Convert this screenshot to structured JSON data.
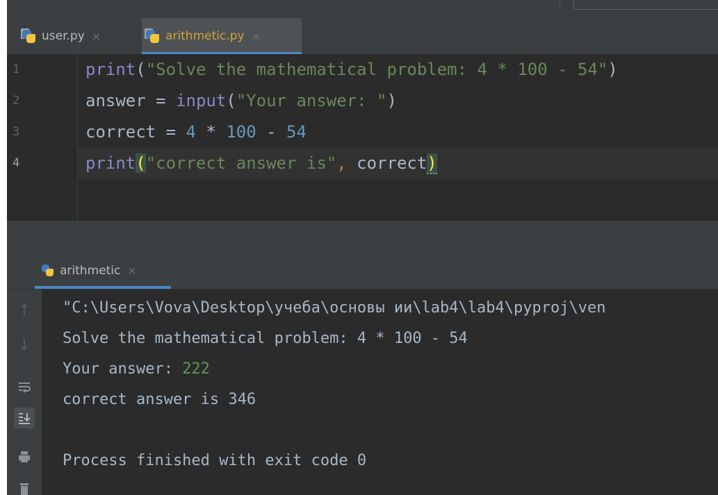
{
  "editor_tabs": [
    {
      "file": "user.py",
      "close": "×"
    },
    {
      "file": "arithmetic.py",
      "close": "×"
    }
  ],
  "line_numbers": [
    "1",
    "2",
    "3",
    "4"
  ],
  "code": {
    "l1_fn": "print",
    "l1_open": "(",
    "l1_str": "\"Solve the mathematical problem: 4 * 100 - 54\"",
    "l1_close": ")",
    "l2_var": "answer = ",
    "l2_fn": "input",
    "l2_open": "(",
    "l2_str": "\"Your answer: \"",
    "l2_close": ")",
    "l3_var": "correct = ",
    "l3_n1": "4",
    "l3_op1": " * ",
    "l3_n2": "100",
    "l3_op2": " - ",
    "l3_n3": "54",
    "l4_fn": "print",
    "l4_open": "(",
    "l4_str": "\"correct answer is\"",
    "l4_comma": ",",
    "l4_arg": " correct",
    "l4_close": ")"
  },
  "run_tab": {
    "label": "arithmetic",
    "close": "×"
  },
  "console": {
    "line1": "\"C:\\Users\\Vova\\Desktop\\учеба\\основы ии\\lab4\\lab4\\pyproj\\ven",
    "line2": "Solve the mathematical problem: 4 * 100 - 54",
    "line3_prompt": "Your answer: ",
    "line3_input": "222",
    "line4": "correct answer is 346",
    "line5": "Process finished with exit code 0"
  },
  "sidebar_icons": [
    "arrow-up-icon",
    "arrow-down-icon",
    "soft-wrap-icon",
    "scroll-to-end-icon",
    "print-icon",
    "trash-icon"
  ],
  "colors": {
    "editor_bg": "#2b2b2b",
    "keyword": "#8888c6",
    "string": "#6a8759",
    "number": "#6897bb",
    "user_input": "#629755",
    "accent": "#4a88c7"
  }
}
